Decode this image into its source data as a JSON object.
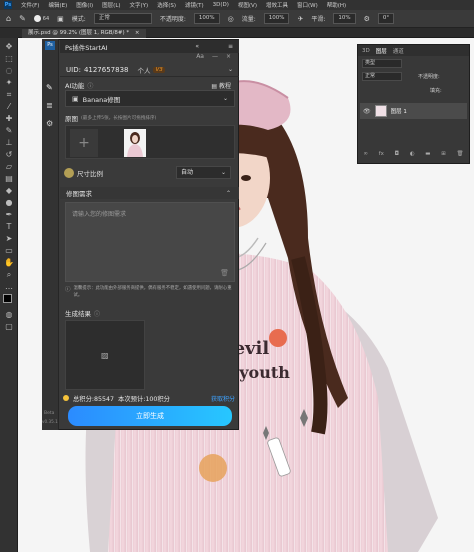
{
  "menubar": {
    "app_logo": "Ps",
    "items": [
      "文件(F)",
      "编辑(E)",
      "图像(I)",
      "图层(L)",
      "文字(Y)",
      "选择(S)",
      "滤镜(T)",
      "3D(D)",
      "视图(V)",
      "增效工具",
      "窗口(W)",
      "帮助(H)"
    ]
  },
  "options": {
    "size": "64",
    "mode_label": "模式:",
    "mode_value": "正常",
    "opacity_label": "不透明度:",
    "opacity_value": "100%",
    "flow_label": "流量:",
    "flow_value": "100%",
    "smooth_label": "平滑:",
    "smooth_value": "10%",
    "angle_value": "0°"
  },
  "document_tab": "展示.psd @ 99.2% (图层 1, RGB/8#) *",
  "plugin": {
    "title": "Ps插件StartAI",
    "uid_label": "UID:",
    "uid_value": "4127657838",
    "plan": "个人",
    "plan_badge": "V3",
    "ai_func_label": "AI功能",
    "tutorial": "教程",
    "function_value": "Banana修图",
    "original_label": "原图",
    "original_hint": "(最多上传5张，长按图片可拖拽排序)",
    "ratio_label": "尺寸比例",
    "ratio_value": "自动",
    "requirement_label": "修图需求",
    "requirement_placeholder": "请输入您的修图需求",
    "notice": "温馨提示：此功能由外部服务商提供，偶有服务不稳定，如遇使用问题，请耐心重试。",
    "result_label": "生成结果",
    "points_text": "总积分:85547",
    "estimate_text": "本次预计:100积分",
    "get_points": "获取积分",
    "generate_button": "立即生成"
  },
  "layers_panel": {
    "tabs": [
      "3D",
      "图层",
      "通道"
    ],
    "kind": "类型",
    "blend": "正常",
    "opacity_label": "不透明度:",
    "fill_label": "填充:",
    "layer_name": "图层 1"
  },
  "canvas_text": {
    "shirt_line1": "devil",
    "shirt_line2": "leyouth"
  },
  "status": {
    "beta": "Beta",
    "version": "v0.35.1"
  },
  "colors": {
    "accent_blue": "#2b8bff",
    "accent_cyan": "#27c7ff",
    "points_yellow": "#f5c33b",
    "badge_orange": "#f09a2a"
  }
}
